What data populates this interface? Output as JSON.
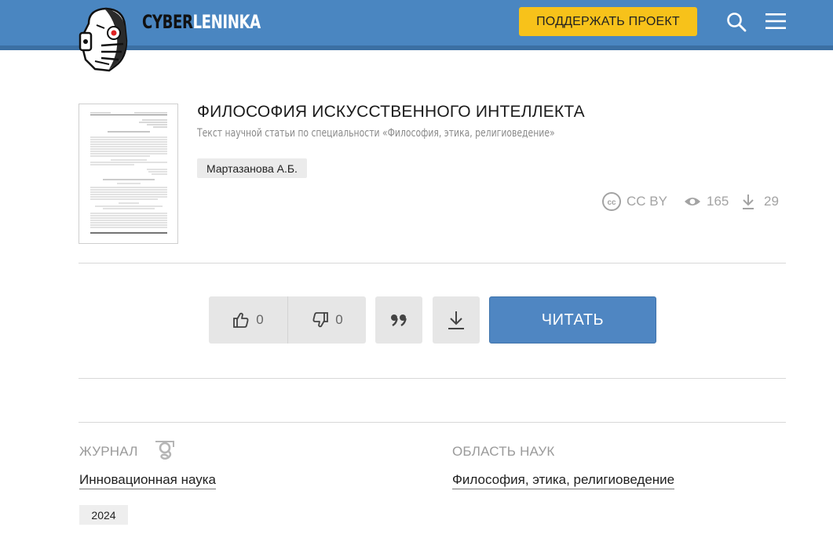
{
  "header": {
    "logo_part1": "CYBER",
    "logo_part2": "LENINKA",
    "support_label": "ПОДДЕРЖАТЬ ПРОЕКТ",
    "icons": [
      "mascot-logo",
      "search-icon",
      "menu-icon"
    ],
    "colors": {
      "bar": "#4a86c1",
      "support": "#f7c21a"
    }
  },
  "article": {
    "title": "ФИЛОСОФИЯ ИСКУССТВЕННОГО ИНТЕЛЛЕКТА",
    "subtitle": "Текст научной статьи по специальности «Философия, этика, религиоведение»",
    "author": "Мартазанова А.Б.",
    "license": "CC BY",
    "views": "165",
    "downloads": "29"
  },
  "actions": {
    "likes": "0",
    "dislikes": "0",
    "read_label": "ЧИТАТЬ",
    "icons": [
      "thumbs-up-icon",
      "thumbs-down-icon",
      "quote-icon",
      "download-icon"
    ],
    "read_color": "#4f86c2"
  },
  "info": {
    "journal_label": "ЖУРНАЛ",
    "journal_name": "Инновационная наука",
    "field_label": "ОБЛАСТЬ НАУК",
    "field_name": "Философия, этика, религиоведение",
    "year": "2024"
  }
}
